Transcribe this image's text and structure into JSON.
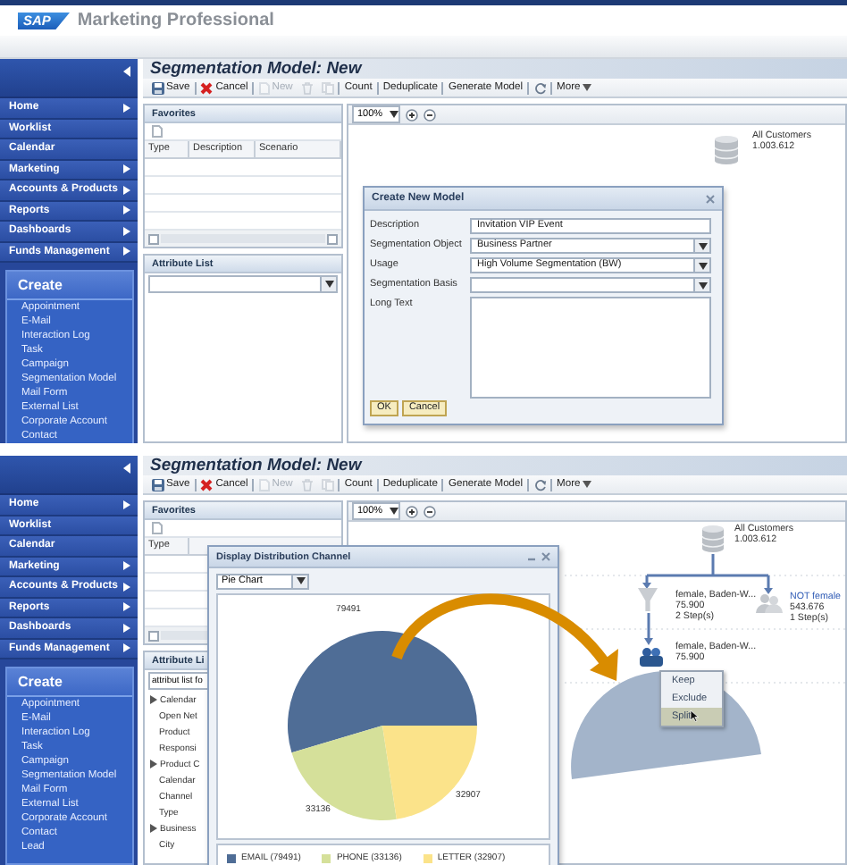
{
  "screens": [
    {
      "header": {
        "logo": "SAP",
        "title": "Marketing Professional"
      },
      "sidebar": {
        "items": [
          {
            "label": "Home",
            "expandable": true
          },
          {
            "label": "Worklist",
            "expandable": false
          },
          {
            "label": "Calendar",
            "expandable": false
          },
          {
            "label": "Marketing",
            "expandable": true
          },
          {
            "label": "Accounts & Products",
            "expandable": true
          },
          {
            "label": "Reports",
            "expandable": true
          },
          {
            "label": "Dashboards",
            "expandable": true
          },
          {
            "label": "Funds Management",
            "expandable": true
          }
        ],
        "create": {
          "title": "Create",
          "items": [
            "Appointment",
            "E-Mail",
            "Interaction Log",
            "Task",
            "Campaign",
            "Segmentation Model",
            "Mail Form",
            "External List",
            "Corporate Account",
            "Contact"
          ]
        }
      },
      "page_title": "Segmentation Model: New",
      "toolbar": [
        {
          "kind": "save",
          "label": "Save",
          "disabled": false
        },
        {
          "kind": "cancel",
          "label": "Cancel",
          "disabled": false
        },
        {
          "kind": "new",
          "label": "New",
          "disabled": true
        },
        {
          "kind": "delete",
          "disabled": true
        },
        {
          "kind": "copy",
          "disabled": true
        },
        {
          "kind": "text",
          "label": "Count",
          "disabled": false
        },
        {
          "kind": "text",
          "label": "Deduplicate",
          "disabled": false
        },
        {
          "kind": "text",
          "label": "Generate Model",
          "disabled": false
        },
        {
          "kind": "refresh",
          "disabled": false
        },
        {
          "kind": "menu",
          "label": "More",
          "disabled": false
        }
      ],
      "favorites": {
        "title": "Favorites",
        "columns": [
          "Type",
          "Description",
          "Scenario"
        ]
      },
      "attribute_list": {
        "title": "Attribute List",
        "field": {
          "kind": "select"
        }
      },
      "canvas": {
        "zoom": "100%",
        "nodes": [
          {
            "kind": "database",
            "label": "All Customers",
            "count": "1.003.612",
            "link": false
          }
        ]
      },
      "dialog": {
        "kind": "form",
        "title": "Create New Model",
        "fields": [
          {
            "kind": "input",
            "label": "Description",
            "value": "Invitation VIP Event"
          },
          {
            "kind": "select",
            "label": "Segmentation Object",
            "value": "Business Partner"
          },
          {
            "kind": "select",
            "label": "Usage",
            "value": "High Volume Segmentation (BW)"
          },
          {
            "kind": "select",
            "label": "Segmentation Basis"
          },
          {
            "kind": "textarea",
            "label": "Long Text"
          }
        ],
        "buttons": [
          "OK",
          "Cancel"
        ]
      }
    },
    {
      "callout": true,
      "sidebar": {
        "items": [
          {
            "label": "Home",
            "expandable": true
          },
          {
            "label": "Worklist",
            "expandable": false
          },
          {
            "label": "Calendar",
            "expandable": false
          },
          {
            "label": "Marketing",
            "expandable": true
          },
          {
            "label": "Accounts & Products",
            "expandable": true
          },
          {
            "label": "Reports",
            "expandable": true
          },
          {
            "label": "Dashboards",
            "expandable": true
          },
          {
            "label": "Funds Management",
            "expandable": true
          }
        ],
        "create": {
          "title": "Create",
          "items": [
            "Appointment",
            "E-Mail",
            "Interaction Log",
            "Task",
            "Campaign",
            "Segmentation Model",
            "Mail Form",
            "External List",
            "Corporate Account",
            "Contact",
            "Lead"
          ]
        }
      },
      "page_title": "Segmentation Model: New",
      "toolbar": [
        {
          "kind": "save",
          "label": "Save",
          "disabled": false
        },
        {
          "kind": "cancel",
          "label": "Cancel",
          "disabled": false
        },
        {
          "kind": "new",
          "label": "New",
          "disabled": true
        },
        {
          "kind": "delete",
          "disabled": true
        },
        {
          "kind": "copy",
          "disabled": true
        },
        {
          "kind": "text",
          "label": "Count",
          "disabled": false
        },
        {
          "kind": "text",
          "label": "Deduplicate",
          "disabled": false
        },
        {
          "kind": "text",
          "label": "Generate Model",
          "disabled": false
        },
        {
          "kind": "refresh",
          "disabled": false
        },
        {
          "kind": "menu",
          "label": "More",
          "disabled": false
        }
      ],
      "favorites": {
        "title": "Favorites",
        "columns": [
          "Type"
        ]
      },
      "attribute_list": {
        "title": "Attribute Li",
        "field": {
          "kind": "input",
          "value": "attribut list fo"
        },
        "tree": [
          {
            "label": "Calendar",
            "children": [
              {
                "label": "Open Net"
              },
              {
                "label": "Product"
              },
              {
                "label": "Responsi"
              }
            ]
          },
          {
            "label": "Product C",
            "children": [
              {
                "label": "Calendar"
              },
              {
                "label": "Channel"
              },
              {
                "label": "Type"
              }
            ]
          },
          {
            "label": "Business",
            "children": [
              {
                "label": "City"
              }
            ]
          }
        ]
      },
      "canvas": {
        "zoom": "100%",
        "nodes": [
          {
            "kind": "database",
            "label": "All Customers",
            "count": "1.003.612",
            "link": false
          },
          {
            "kind": "filter",
            "label": "female, Baden-W...",
            "count": "75.900",
            "steps": "2 Step(s)",
            "link": false
          },
          {
            "kind": "group",
            "label": "NOT female",
            "count": "543.676",
            "steps": "1 Step(s)",
            "link": true
          },
          {
            "kind": "target",
            "label": "female, Baden-W...",
            "count": "75.900",
            "link": false
          }
        ],
        "menu": [
          {
            "label": "Keep",
            "selected": false
          },
          {
            "label": "Exclude",
            "selected": false
          },
          {
            "label": "Split",
            "selected": true
          }
        ]
      },
      "dialog": {
        "kind": "chart",
        "title": "Display Distribution Channel",
        "select": "Pie Chart",
        "chart_data": {
          "type": "pie",
          "series": [
            {
              "values": [
                79491,
                33136,
                32907
              ]
            }
          ],
          "data_labels": true
        },
        "legend": [
          {
            "label": "EMAIL (79491)",
            "color": "#4f6d96"
          },
          {
            "label": "PHONE (33136)",
            "color": "#d5e09a"
          },
          {
            "label": "LETTER (32907)",
            "color": "#fbe38a"
          }
        ]
      }
    }
  ]
}
